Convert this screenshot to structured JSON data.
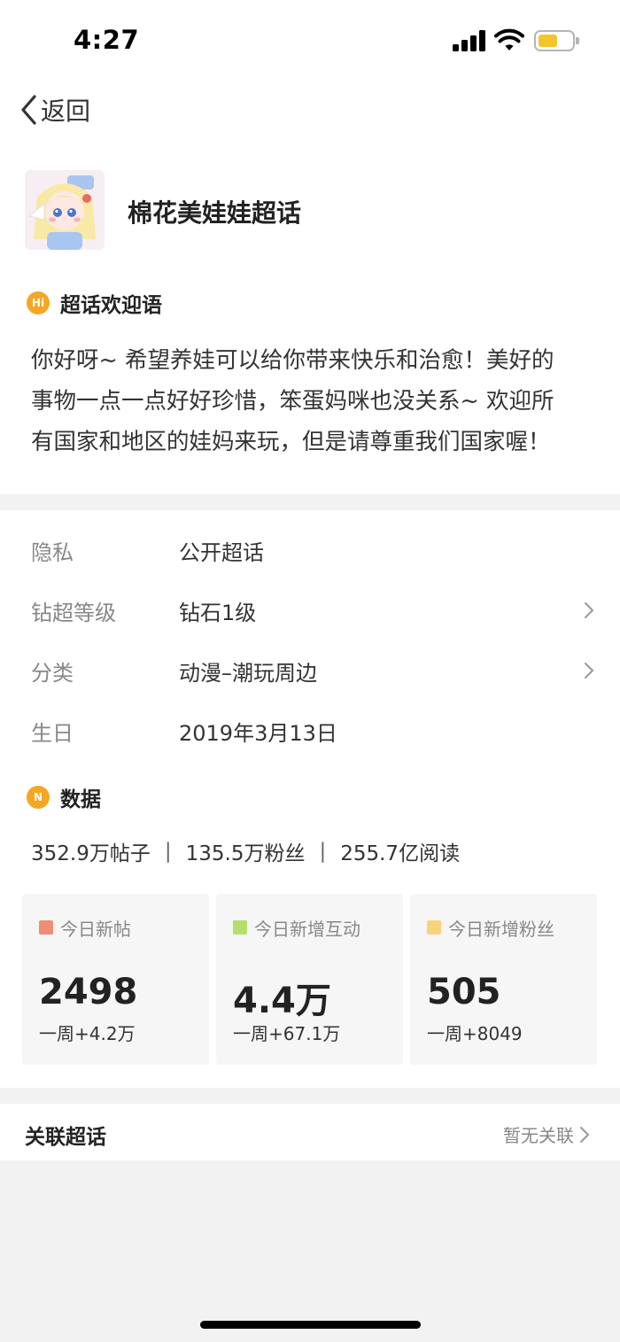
{
  "status_bar": {
    "time": "4:27"
  },
  "nav": {
    "back_label": "返回"
  },
  "topic": {
    "title": "棉花美娃娃超话"
  },
  "welcome": {
    "badge": "Hi",
    "heading": "超话欢迎语",
    "lines": [
      "你好呀~ 希望养娃可以给你带来快乐和治愈！美好的",
      "事物一点一点好好珍惜，笨蛋妈咪也没关系~ 欢迎所",
      "有国家和地区的娃妈来玩，但是请尊重我们国家喔！"
    ]
  },
  "info": [
    {
      "key": "隐私",
      "value": "公开超话"
    },
    {
      "key": "钻超等级",
      "value": "钻石1级"
    },
    {
      "key": "分类",
      "value": "动漫–潮玩周边"
    },
    {
      "key": "生日",
      "value": "2019年3月13日"
    }
  ],
  "data_section": {
    "badge": "N",
    "heading": "数据",
    "posts": "352.9万帖子",
    "fans": "135.5万粉丝",
    "reads": "255.7亿阅读",
    "separator": "|"
  },
  "cards": [
    {
      "title": "今日新帖",
      "value": "2498",
      "week": "一周+4.2万",
      "color": "#ee8e76"
    },
    {
      "title": "今日新增互动",
      "value": "4.4万",
      "week": "一周+67.1万",
      "color": "#b4df6c"
    },
    {
      "title": "今日新增粉丝",
      "value": "505",
      "week": "一周+8049",
      "color": "#f8d37e"
    }
  ],
  "related": {
    "label": "关联超话",
    "status": "暂无关联"
  },
  "colors": {
    "badge_orange": "#f6a623",
    "page_bg": "#f2f2f2"
  }
}
